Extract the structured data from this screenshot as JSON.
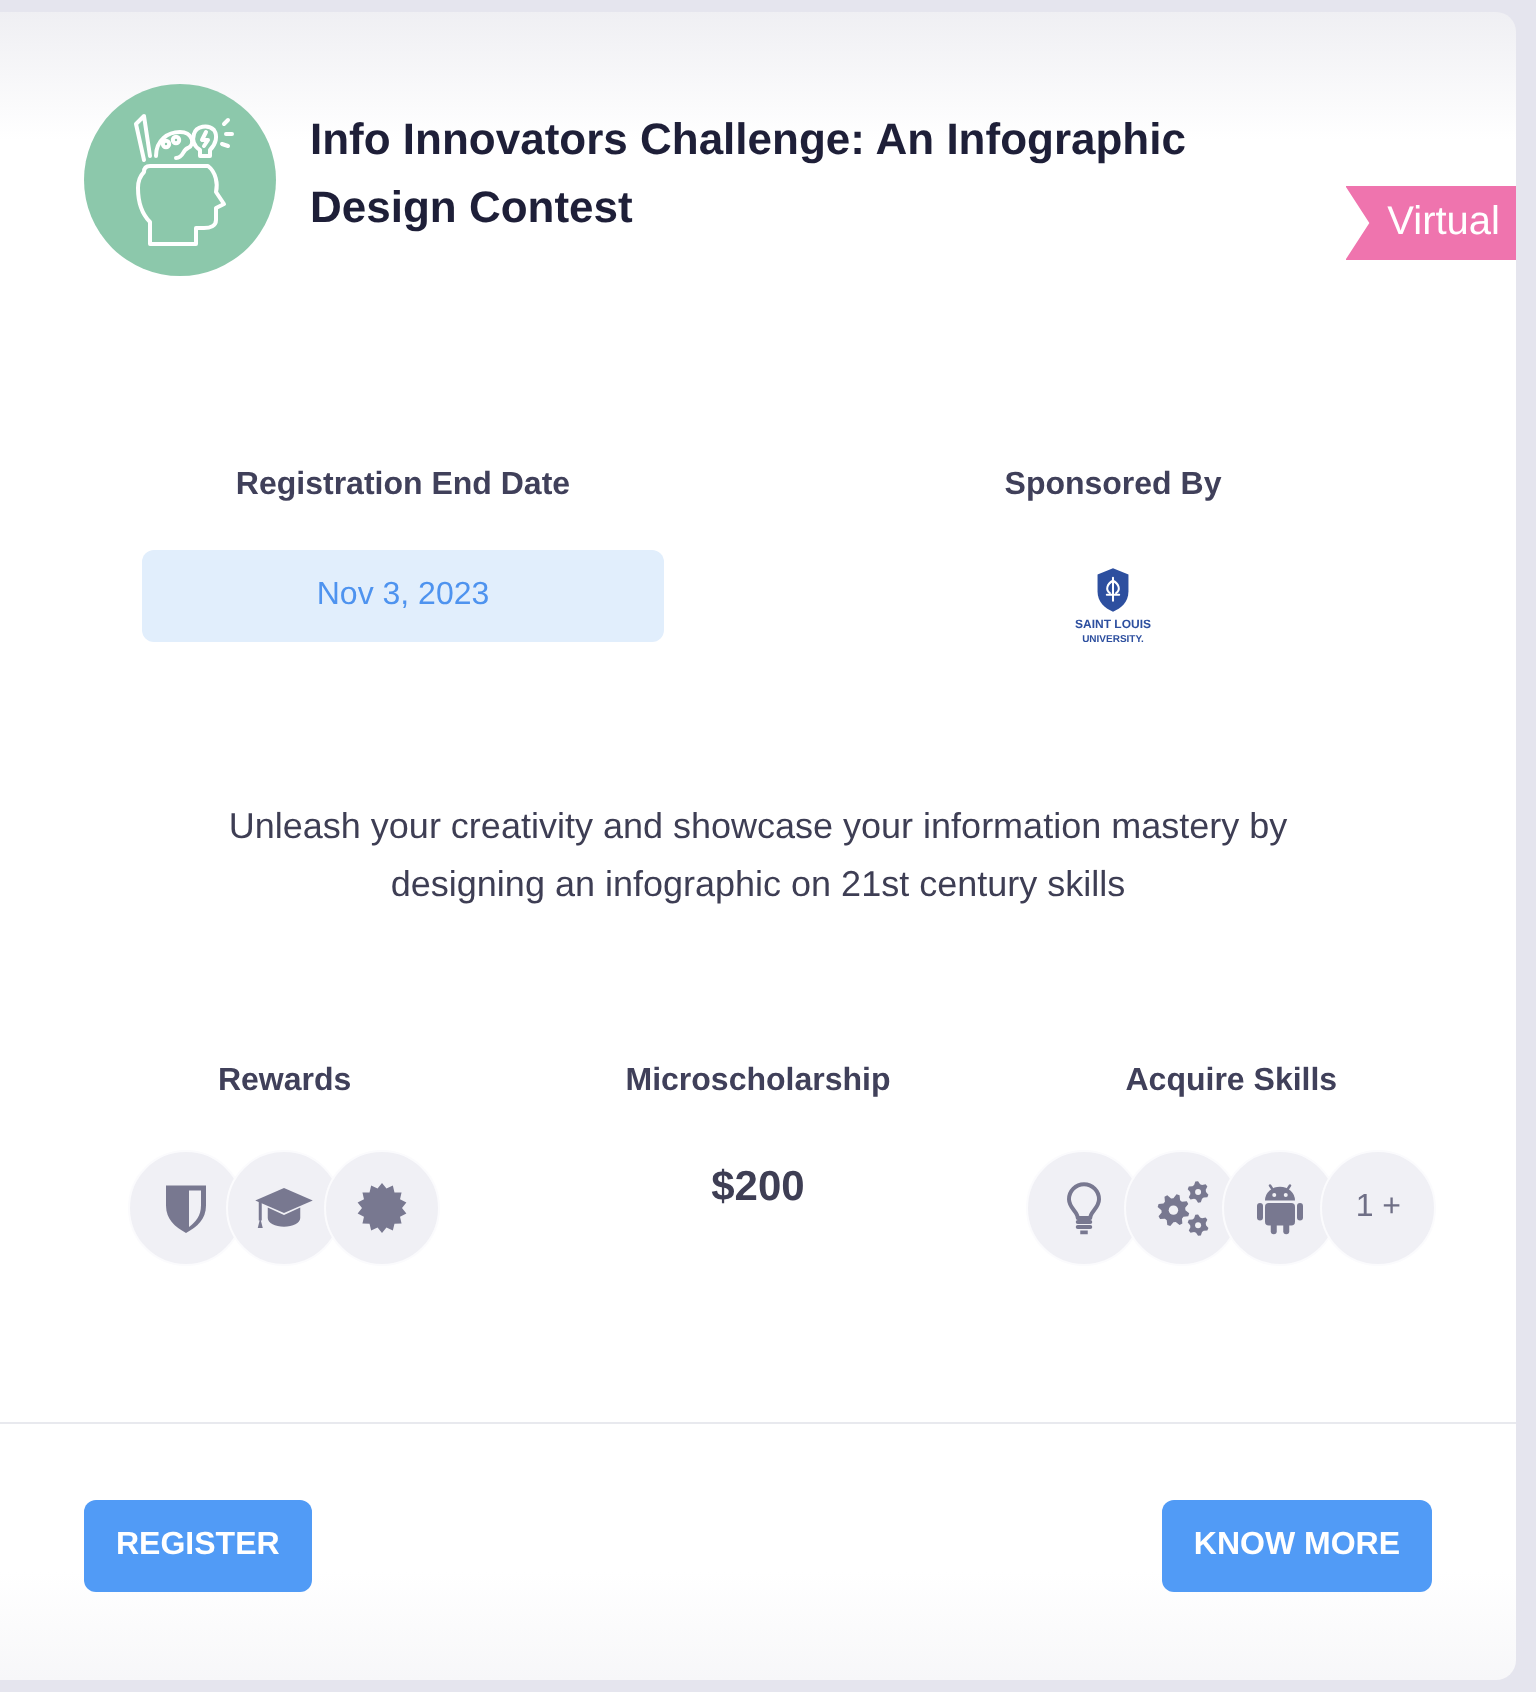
{
  "event": {
    "title": "Info Innovators Challenge: An Infographic Design Contest",
    "mode": "Virtual"
  },
  "registration": {
    "label": "Registration End Date",
    "date": "Nov 3, 2023"
  },
  "sponsor": {
    "label": "Sponsored By",
    "logo_text": [
      "SAINT LOUIS",
      "UNIVERSITY."
    ]
  },
  "description": "Unleash your creativity and showcase your information mastery by designing an infographic on 21st century skills",
  "rewards": {
    "label": "Rewards",
    "items": [
      {
        "kind": "shield"
      },
      {
        "kind": "cap"
      },
      {
        "kind": "seal"
      }
    ]
  },
  "microscholarship": {
    "label": "Microscholarship",
    "amount": "$200"
  },
  "skills": {
    "label": "Acquire Skills",
    "items": [
      {
        "kind": "bulb"
      },
      {
        "kind": "gears"
      },
      {
        "kind": "robot"
      }
    ],
    "more": "1 +"
  },
  "buttons": [
    {
      "label": "REGISTER"
    },
    {
      "label": "KNOW MORE"
    }
  ]
}
